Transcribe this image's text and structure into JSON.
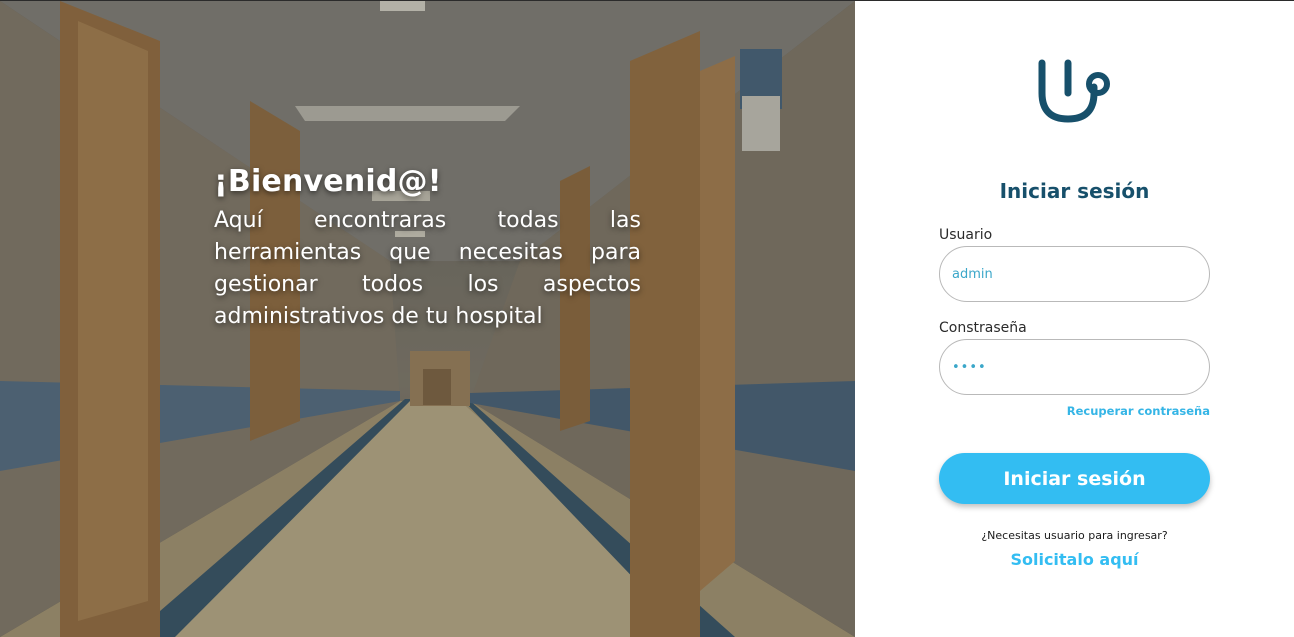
{
  "hero": {
    "title": "¡Bienvenid@!",
    "description": "Aquí encontraras todas las herramientas que necesitas para gestionar todos los aspectos administrativos de tu hospital"
  },
  "login": {
    "logo_icon": "stethoscope-icon",
    "title": "Iniciar sesión",
    "username_label": "Usuario",
    "username_value": "admin",
    "password_label": "Constraseña",
    "password_value": "••••",
    "recover_link": "Recuperar contraseña",
    "submit_label": "Iniciar sesión",
    "need_user_text": "¿Necesitas usuario para ingresar?",
    "request_link": "Solicitalo aquí"
  },
  "colors": {
    "brand_dark": "#17506b",
    "accent": "#33bdf2"
  }
}
